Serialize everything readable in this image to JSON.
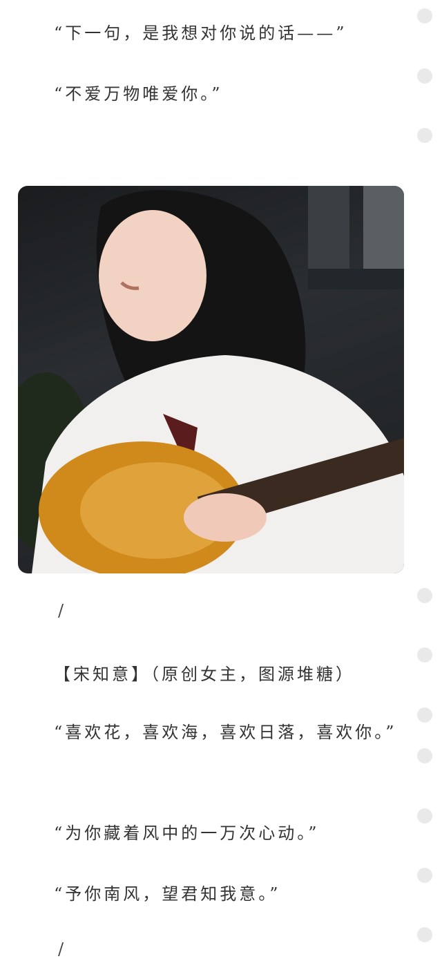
{
  "quote1": "“下一句，是我想对你说的话——”",
  "quote2": "“不爱万物唯爱你。”",
  "divider1": "/",
  "title_line": "【宋知意】（原创女主，图源堆糖）",
  "quote3": "“喜欢花，喜欢海，喜欢日落，喜欢你。”",
  "quote4": "“为你藏着风中的一万次心动。”",
  "quote5": "“予你南风，望君知我意。”",
  "divider2": "/",
  "colors": {
    "text": "#333333",
    "dot": "#e9e9e9",
    "background": "#ffffff"
  }
}
